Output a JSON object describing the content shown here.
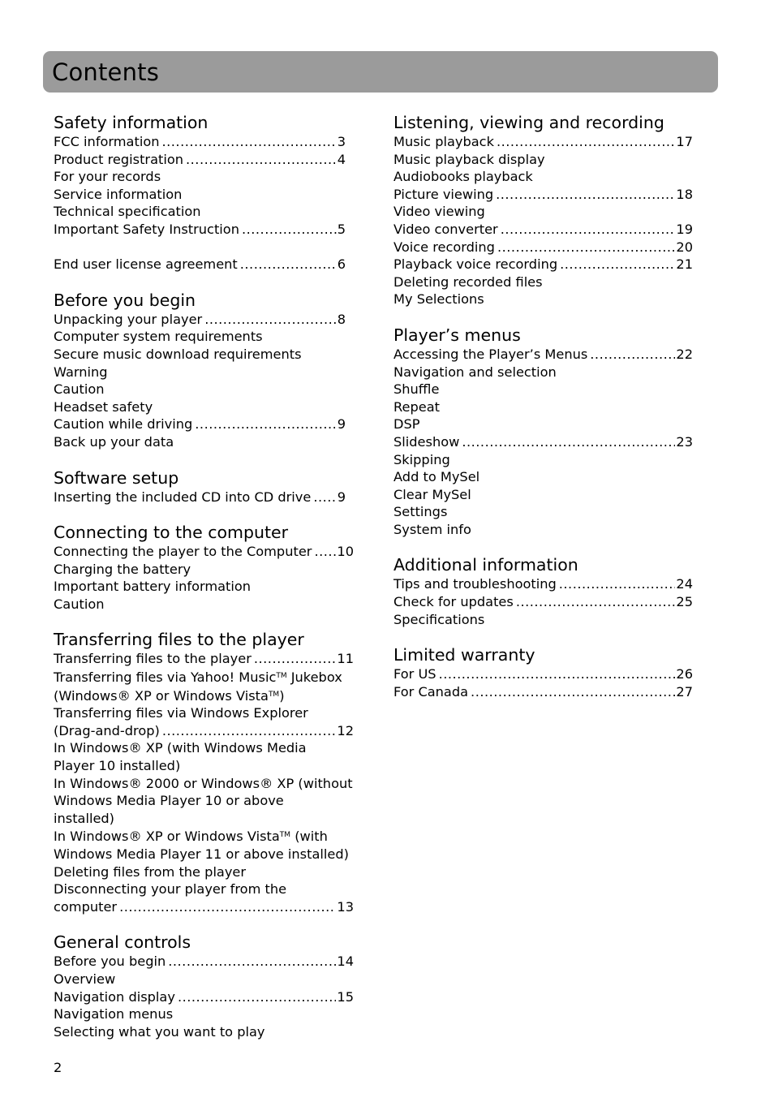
{
  "header": {
    "title": "Contents"
  },
  "left_column": [
    {
      "title": "Safety information",
      "entries": [
        {
          "label": "FCC information",
          "page": "3"
        },
        {
          "label": "Product registration",
          "page": "4"
        },
        {
          "label": "For your records",
          "page": null
        },
        {
          "label": "Service information",
          "page": null
        },
        {
          "label": "Technical specification",
          "page": null
        },
        {
          "label": "Important Safety Instruction",
          "page": "5"
        },
        {
          "label": "End user license agreement",
          "page": "6",
          "gap_before": true
        }
      ]
    },
    {
      "title": "Before you begin",
      "entries": [
        {
          "label": "Unpacking your player",
          "page": "8"
        },
        {
          "label": "Computer system requirements",
          "page": null
        },
        {
          "label": "Secure music download requirements",
          "page": null
        },
        {
          "label": "Warning",
          "page": null
        },
        {
          "label": "Caution",
          "page": null
        },
        {
          "label": "Headset safety",
          "page": null
        },
        {
          "label": "Caution while driving",
          "page": "9"
        },
        {
          "label": "Back up your data",
          "page": null
        }
      ]
    },
    {
      "title": "Software setup",
      "entries": [
        {
          "label": "Inserting the included CD into CD drive",
          "page": "9"
        }
      ]
    },
    {
      "title": "Connecting to the computer",
      "entries": [
        {
          "label": "Connecting the player to the Computer",
          "page": "10"
        },
        {
          "label": "Charging the battery",
          "page": null
        },
        {
          "label": "Important battery information",
          "page": null
        },
        {
          "label": "Caution",
          "page": null
        }
      ]
    },
    {
      "title": "Transferring files to the player",
      "entries": [
        {
          "label": "Transferring files to the player",
          "page": "11"
        },
        {
          "label": "Transferring files via Yahoo! Music™ Jukebox",
          "page": null
        },
        {
          "label": "(Windows® XP or Windows Vista™)",
          "page": null
        },
        {
          "label": "Transferring files via Windows Explorer",
          "page": null
        },
        {
          "label": "(Drag-and-drop)",
          "page": "12"
        },
        {
          "label": "In Windows® XP (with Windows Media",
          "page": null
        },
        {
          "label": "Player 10 installed)",
          "page": null
        },
        {
          "label": "In Windows® 2000 or Windows® XP (without",
          "page": null
        },
        {
          "label": "Windows Media Player 10 or above",
          "page": null
        },
        {
          "label": "installed)",
          "page": null
        },
        {
          "label": "In Windows® XP or Windows Vista™ (with",
          "page": null
        },
        {
          "label": "Windows Media Player 11 or above installed)",
          "page": null
        },
        {
          "label": "Deleting files from the player",
          "page": null
        },
        {
          "label": "Disconnecting your player from the",
          "page": null
        },
        {
          "label": "computer",
          "page": "13"
        }
      ]
    },
    {
      "title": "General controls",
      "entries": [
        {
          "label": "Before you begin",
          "page": "14"
        },
        {
          "label": "Overview",
          "page": null
        },
        {
          "label": "Navigation display",
          "page": "15"
        },
        {
          "label": "Navigation menus",
          "page": null
        },
        {
          "label": "Selecting what you want to play",
          "page": null
        }
      ]
    }
  ],
  "right_column": [
    {
      "title": "Listening, viewing and recording",
      "entries": [
        {
          "label": "Music playback",
          "page": "17"
        },
        {
          "label": "Music playback display",
          "page": null
        },
        {
          "label": "Audiobooks playback",
          "page": null
        },
        {
          "label": "Picture viewing",
          "page": "18"
        },
        {
          "label": "Video viewing",
          "page": null
        },
        {
          "label": "Video converter",
          "page": "19"
        },
        {
          "label": "Voice recording",
          "page": "20"
        },
        {
          "label": "Playback voice recording",
          "page": "21"
        },
        {
          "label": "Deleting recorded files",
          "page": null
        },
        {
          "label": "My Selections",
          "page": null
        }
      ]
    },
    {
      "title": "Player’s menus",
      "entries": [
        {
          "label": "Accessing the Player’s Menus",
          "page": "22"
        },
        {
          "label": "Navigation and selection",
          "page": null
        },
        {
          "label": "Shuffle",
          "page": null
        },
        {
          "label": "Repeat",
          "page": null
        },
        {
          "label": "DSP",
          "page": null
        },
        {
          "label": "Slideshow",
          "page": "23"
        },
        {
          "label": "Skipping",
          "page": null
        },
        {
          "label": "Add to MySel",
          "page": null
        },
        {
          "label": "Clear MySel",
          "page": null
        },
        {
          "label": "Settings",
          "page": null
        },
        {
          "label": "System info",
          "page": null
        }
      ]
    },
    {
      "title": "Additional information",
      "entries": [
        {
          "label": "Tips and troubleshooting",
          "page": "24"
        },
        {
          "label": "Check for updates",
          "page": "25"
        },
        {
          "label": "Specifications",
          "page": null
        }
      ]
    },
    {
      "title": "Limited warranty",
      "entries": [
        {
          "label": "For US",
          "page": "26"
        },
        {
          "label": "For Canada",
          "page": "27"
        }
      ]
    }
  ],
  "footer": {
    "page_number": "2"
  }
}
